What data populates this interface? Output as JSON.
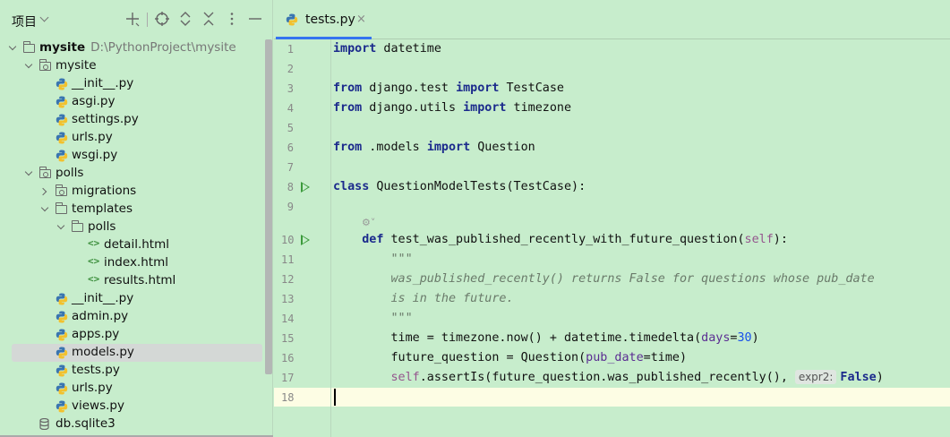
{
  "sidebar": {
    "title": "项目",
    "toolbar_icons": [
      "add-icon",
      "locate-icon",
      "expand-all-icon",
      "collapse-all-icon",
      "more-icon",
      "minimize-icon"
    ],
    "tree": [
      {
        "label": "mysite",
        "path": "D:\\PythonProject\\mysite",
        "type": "root-folder",
        "depth": 0,
        "expanded": true
      },
      {
        "label": "mysite",
        "type": "package",
        "depth": 1,
        "expanded": true
      },
      {
        "label": "__init__.py",
        "type": "py",
        "depth": 2
      },
      {
        "label": "asgi.py",
        "type": "py",
        "depth": 2
      },
      {
        "label": "settings.py",
        "type": "py",
        "depth": 2
      },
      {
        "label": "urls.py",
        "type": "py",
        "depth": 2
      },
      {
        "label": "wsgi.py",
        "type": "py",
        "depth": 2
      },
      {
        "label": "polls",
        "type": "package",
        "depth": 1,
        "expanded": true
      },
      {
        "label": "migrations",
        "type": "package",
        "depth": 2,
        "expanded": false
      },
      {
        "label": "templates",
        "type": "folder",
        "depth": 2,
        "expanded": true
      },
      {
        "label": "polls",
        "type": "folder",
        "depth": 3,
        "expanded": true
      },
      {
        "label": "detail.html",
        "type": "html",
        "depth": 4
      },
      {
        "label": "index.html",
        "type": "html",
        "depth": 4
      },
      {
        "label": "results.html",
        "type": "html",
        "depth": 4
      },
      {
        "label": "__init__.py",
        "type": "py",
        "depth": 2
      },
      {
        "label": "admin.py",
        "type": "py",
        "depth": 2
      },
      {
        "label": "apps.py",
        "type": "py",
        "depth": 2
      },
      {
        "label": "models.py",
        "type": "py",
        "depth": 2,
        "selected": true
      },
      {
        "label": "tests.py",
        "type": "py",
        "depth": 2
      },
      {
        "label": "urls.py",
        "type": "py",
        "depth": 2
      },
      {
        "label": "views.py",
        "type": "py",
        "depth": 2
      },
      {
        "label": "db.sqlite3",
        "type": "db",
        "depth": 1
      }
    ]
  },
  "editor": {
    "tab": {
      "label": "tests.py",
      "close": "×"
    },
    "line_numbers": [
      "1",
      "2",
      "3",
      "4",
      "5",
      "6",
      "7",
      "8",
      "9",
      "10",
      "11",
      "12",
      "13",
      "14",
      "15",
      "16",
      "17",
      "18"
    ],
    "run_gutter_lines": [
      "8",
      "10"
    ],
    "inlay_hint": "expr2:",
    "lines": [
      [
        [
          "kw",
          "import"
        ],
        [
          "t",
          " datetime"
        ]
      ],
      [],
      [
        [
          "kw",
          "from"
        ],
        [
          "t",
          " django.test "
        ],
        [
          "kw",
          "import"
        ],
        [
          "t",
          " TestCase"
        ]
      ],
      [
        [
          "kw",
          "from"
        ],
        [
          "t",
          " django.utils "
        ],
        [
          "kw",
          "import"
        ],
        [
          "t",
          " timezone"
        ]
      ],
      [],
      [
        [
          "kw",
          "from"
        ],
        [
          "t",
          " .models "
        ],
        [
          "kw",
          "import"
        ],
        [
          "t",
          " Question"
        ]
      ],
      [],
      [
        [
          "kw",
          "class"
        ],
        [
          "t",
          " QuestionModelTests(TestCase):"
        ]
      ],
      [],
      [],
      [
        [
          "t",
          "    "
        ],
        [
          "kw",
          "def"
        ],
        [
          "t",
          " test_was_published_recently_with_future_question("
        ],
        [
          "self",
          "self"
        ],
        [
          "t",
          "):"
        ]
      ],
      [
        [
          "t",
          "        "
        ],
        [
          "str",
          "\"\"\""
        ]
      ],
      [
        [
          "t",
          "        "
        ],
        [
          "str",
          "was_published_recently() returns False for questions whose pub_date"
        ]
      ],
      [
        [
          "t",
          "        "
        ],
        [
          "str",
          "is in the future."
        ]
      ],
      [
        [
          "t",
          "        "
        ],
        [
          "str",
          "\"\"\""
        ]
      ],
      [
        [
          "t",
          "        time = timezone.now() + datetime.timedelta("
        ],
        [
          "param",
          "days"
        ],
        [
          "t",
          "="
        ],
        [
          "num",
          "30"
        ],
        [
          "t",
          ")"
        ]
      ],
      [
        [
          "t",
          "        future_question = Question("
        ],
        [
          "param",
          "pub_date"
        ],
        [
          "t",
          "=time)"
        ]
      ],
      [
        [
          "t",
          "        "
        ],
        [
          "self",
          "self"
        ],
        [
          "t",
          ".assertIs(future_question.was_published_recently(),"
        ],
        [
          "hint",
          "expr2:"
        ],
        [
          "kwb",
          "False"
        ],
        [
          "t",
          ")"
        ]
      ],
      []
    ]
  },
  "colors": {
    "background": "#c7edcc",
    "accent": "#3574f0",
    "keyword": "#1b2a8c",
    "run": "#3c9a3c"
  }
}
